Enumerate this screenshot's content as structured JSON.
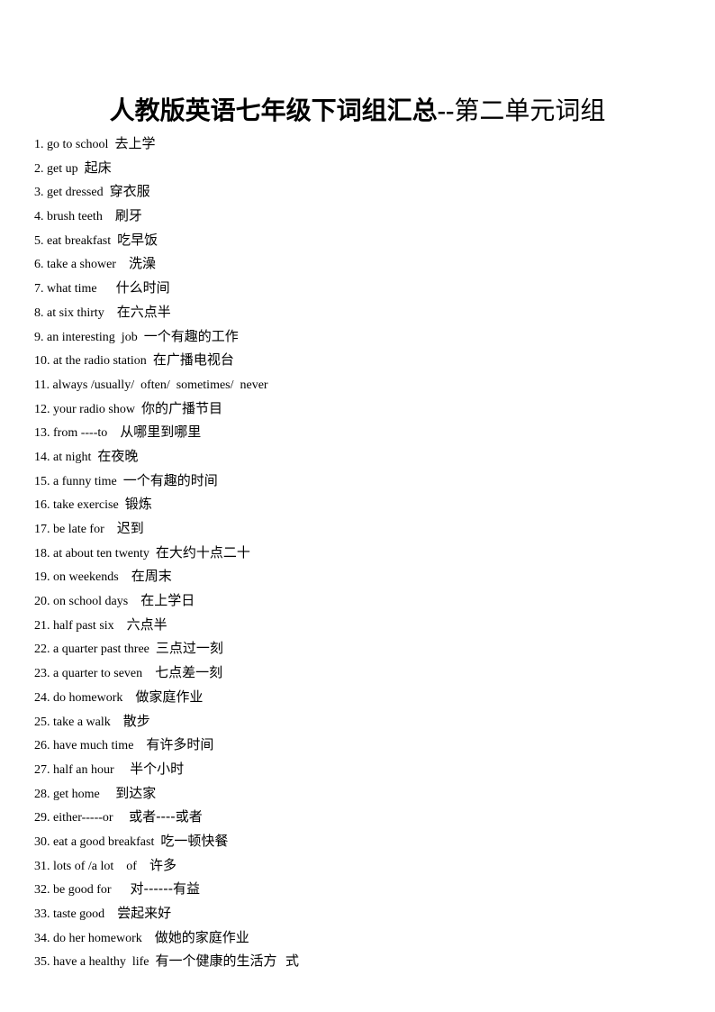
{
  "title": {
    "bold_part": "人教版英语七年级下词组汇总--",
    "normal_part": "第二单元词组"
  },
  "items": [
    {
      "en": "1. go to school  ",
      "zh": "去上学"
    },
    {
      "en": "2. get up  ",
      "zh": "起床"
    },
    {
      "en": "3. get dressed  ",
      "zh": "穿衣服"
    },
    {
      "en": "4. brush teeth    ",
      "zh": "刷牙"
    },
    {
      "en": "5. eat breakfast  ",
      "zh": "吃早饭"
    },
    {
      "en": "6. take a shower    ",
      "zh": "洗澡"
    },
    {
      "en": "7. what time      ",
      "zh": "什么时间"
    },
    {
      "en": "8. at six thirty    ",
      "zh": "在六点半"
    },
    {
      "en": "9. an interesting  job  ",
      "zh": "一个有趣的工作"
    },
    {
      "en": "10. at the radio station  ",
      "zh": "在广播电视台"
    },
    {
      "en": "11. always /usually/  often/  sometimes/  never",
      "zh": ""
    },
    {
      "en": "12. your radio show  ",
      "zh": "你的广播节目"
    },
    {
      "en": "13. from ----to    ",
      "zh": "从哪里到哪里"
    },
    {
      "en": "14. at night  ",
      "zh": "在夜晚"
    },
    {
      "en": "15. a funny time  ",
      "zh": "一个有趣的时间"
    },
    {
      "en": "16. take exercise  ",
      "zh": "锻炼"
    },
    {
      "en": "17. be late for    ",
      "zh": "迟到"
    },
    {
      "en": "18. at about ten twenty  ",
      "zh": "在大约十点二十"
    },
    {
      "en": "19. on weekends    ",
      "zh": "在周末"
    },
    {
      "en": "20. on school days    ",
      "zh": "在上学日"
    },
    {
      "en": "21. half past six    ",
      "zh": "六点半"
    },
    {
      "en": "22. a quarter past three  ",
      "zh": "三点过一刻"
    },
    {
      "en": "23. a quarter to seven    ",
      "zh": "七点差一刻"
    },
    {
      "en": "24. do homework    ",
      "zh": "做家庭作业"
    },
    {
      "en": "25. take a walk    ",
      "zh": "散步"
    },
    {
      "en": "26. have much time    ",
      "zh": "有许多时间"
    },
    {
      "en": "27. half an hour     ",
      "zh": "半个小时"
    },
    {
      "en": "28. get home     ",
      "zh": "到达家"
    },
    {
      "en": "29. either-----or     ",
      "zh": "或者----或者"
    },
    {
      "en": "30. eat a good breakfast  ",
      "zh": "吃一顿快餐"
    },
    {
      "en": "31. lots of /a lot    of    ",
      "zh": "许多"
    },
    {
      "en": "32. be good for      ",
      "zh": "对------有益"
    },
    {
      "en": "33. taste good    ",
      "zh": "尝起来好"
    },
    {
      "en": "34. do her homework    ",
      "zh": "做她的家庭作业"
    },
    {
      "en": "35. have a healthy  life  ",
      "zh": "有一个健康的生活方  式"
    }
  ]
}
